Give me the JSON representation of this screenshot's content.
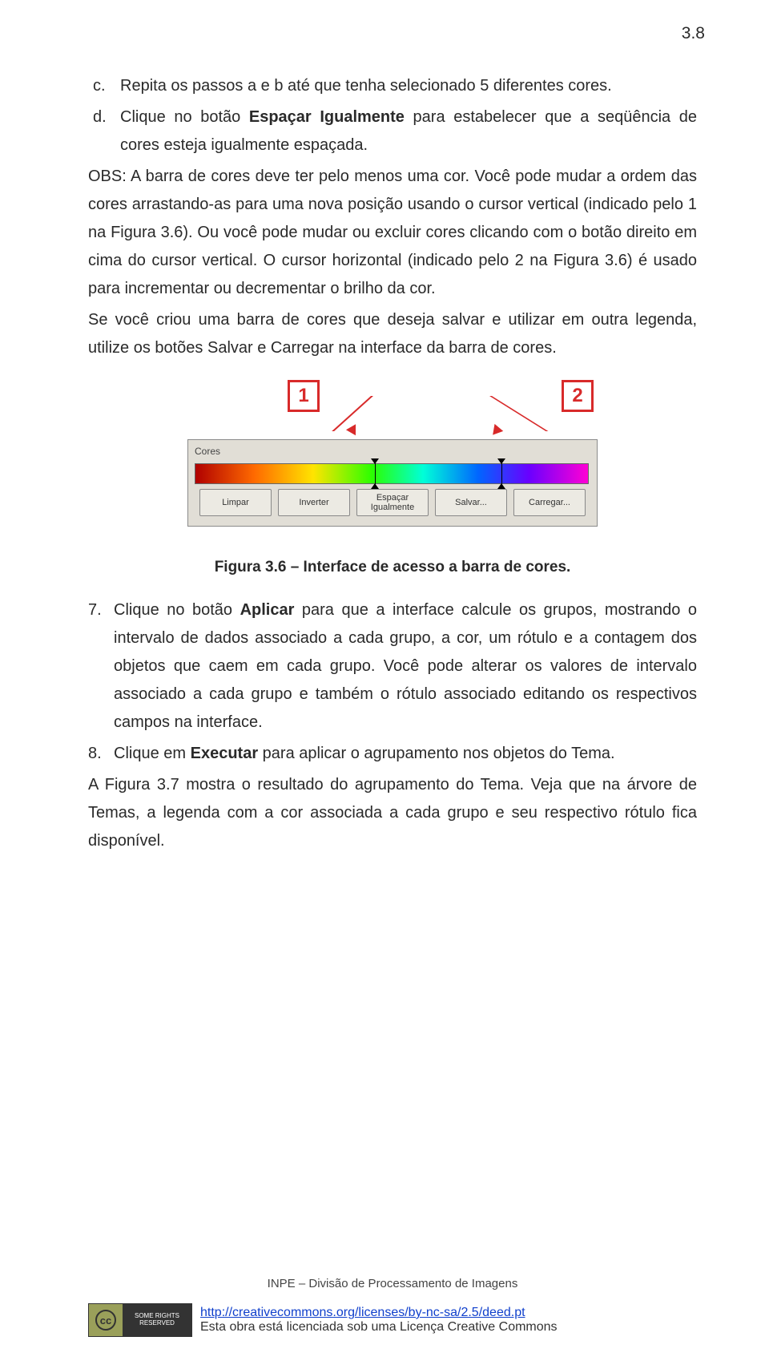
{
  "page_number": "3.8",
  "items": {
    "c": {
      "mark": "c.",
      "text": "Repita os passos a e b até que tenha selecionado 5 diferentes cores."
    },
    "d": {
      "mark": "d.",
      "prefix": "Clique no botão ",
      "bold": "Espaçar Igualmente",
      "suffix": " para estabelecer que a seqüência de cores esteja igualmente espaçada."
    }
  },
  "obs_para": "OBS: A barra de cores deve ter pelo menos uma cor. Você pode mudar a ordem das cores arrastando-as para uma nova posição usando o cursor vertical (indicado pelo 1 na Figura 3.6). Ou você pode mudar ou excluir cores clicando com o botão direito em cima do cursor vertical. O cursor horizontal (indicado pelo 2 na Figura 3.6) é usado para incrementar ou decrementar o brilho da cor.",
  "save_para": "Se você criou uma barra de cores que deseja salvar e utilizar em outra legenda, utilize os botões Salvar e Carregar na interface da barra de cores.",
  "figure": {
    "marker1": "1",
    "marker2": "2",
    "panel_title": "Cores",
    "buttons": {
      "limpar": "Limpar",
      "inverter": "Inverter",
      "espacar": "Espaçar Igualmente",
      "salvar": "Salvar...",
      "carregar": "Carregar..."
    },
    "caption": "Figura 3.6 – Interface de acesso a barra de cores."
  },
  "num7": {
    "mark": "7.",
    "prefix": "Clique no botão ",
    "bold": "Aplicar",
    "suffix": " para que a interface calcule os grupos, mostrando o intervalo de dados associado a cada grupo, a cor, um rótulo e a contagem dos objetos que caem em cada grupo. Você pode alterar os valores de intervalo associado a cada grupo e também o rótulo associado editando os respectivos campos na interface."
  },
  "num8": {
    "mark": "8.",
    "prefix": "Clique em ",
    "bold": "Executar",
    "suffix": " para aplicar o agrupamento nos objetos do Tema."
  },
  "final_para": "A Figura 3.7 mostra o resultado do agrupamento do Tema. Veja que na árvore de Temas, a legenda com a cor associada a cada grupo e seu respectivo rótulo fica disponível.",
  "footer": {
    "org": "INPE – Divisão de Processamento de Imagens",
    "cc_symbol": "cc",
    "cc_badge_right": "SOME RIGHTS RESERVED",
    "url": "http://creativecommons.org/licenses/by-nc-sa/2.5/deed.pt",
    "line2": "Esta obra está licenciada sob uma Licença Creative Commons"
  }
}
